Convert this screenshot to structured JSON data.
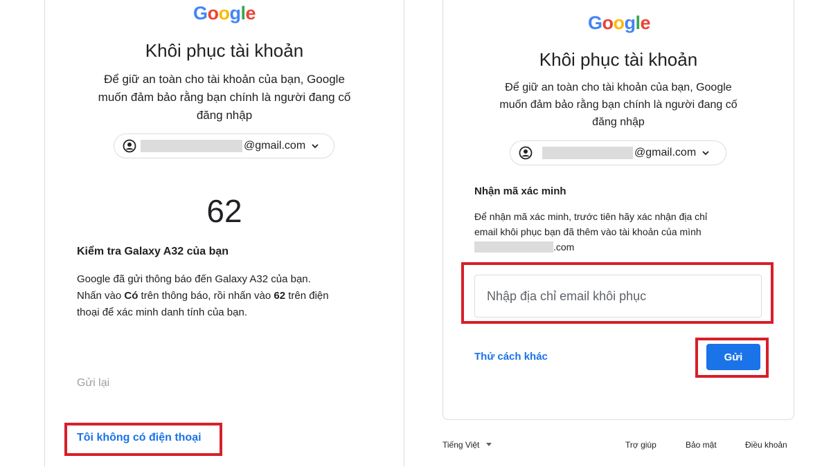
{
  "left": {
    "logo": [
      "G",
      "o",
      "o",
      "g",
      "l",
      "e"
    ],
    "title": "Khôi phục tài khoản",
    "subtitle_line1": "Để giữ an toàn cho tài khoản của bạn, Google",
    "subtitle_line2": "muốn đảm bảo rằng bạn chính là người đang cố",
    "subtitle_line3": "đăng nhập",
    "account_email_suffix": "@gmail.com",
    "number": "62",
    "heading": "Kiểm tra Galaxy A32 của bạn",
    "body_line1": "Google đã gửi thông báo đến Galaxy A32 của bạn.",
    "body_line2_a": "Nhấn vào ",
    "body_line2_bold1": "Có",
    "body_line2_b": " trên thông báo, rồi nhấn vào ",
    "body_line2_bold2": "62",
    "body_line2_c": " trên điện",
    "body_line3": "thoại để xác minh danh tính của bạn.",
    "resend_label": "Gửi lại",
    "no_phone_link": "Tôi không có điện thoại"
  },
  "right": {
    "logo": [
      "G",
      "o",
      "o",
      "g",
      "l",
      "e"
    ],
    "title": "Khôi phục tài khoản",
    "subtitle_line1": "Để giữ an toàn cho tài khoản của bạn, Google",
    "subtitle_line2": "muốn đảm bảo rằng bạn chính là người đang cố",
    "subtitle_line3": "đăng nhập",
    "account_email_suffix": "@gmail.com",
    "heading": "Nhận mã xác minh",
    "body_line1": "Để nhận mã xác minh, trước tiên hãy xác nhận địa chỉ",
    "body_line2": "email khôi phục bạn đã thêm vào tài khoản của mình",
    "body_line3_suffix": ".com",
    "input_placeholder": "Nhập địa chỉ email khôi phục",
    "try_another_link": "Thử cách khác",
    "send_button": "Gửi"
  },
  "footer": {
    "language": "Tiếng Việt",
    "help": "Trợ giúp",
    "privacy": "Bảo mật",
    "terms": "Điều khoản"
  },
  "colors": {
    "accent": "#1a73e8",
    "highlight_box": "#d71f28",
    "logo_blue": "#4285f4",
    "logo_red": "#ea4335",
    "logo_yellow": "#fbbc05",
    "logo_green": "#34a853"
  },
  "icons": [
    "account-circle-icon",
    "chevron-down-icon",
    "dropdown-caret-icon"
  ]
}
